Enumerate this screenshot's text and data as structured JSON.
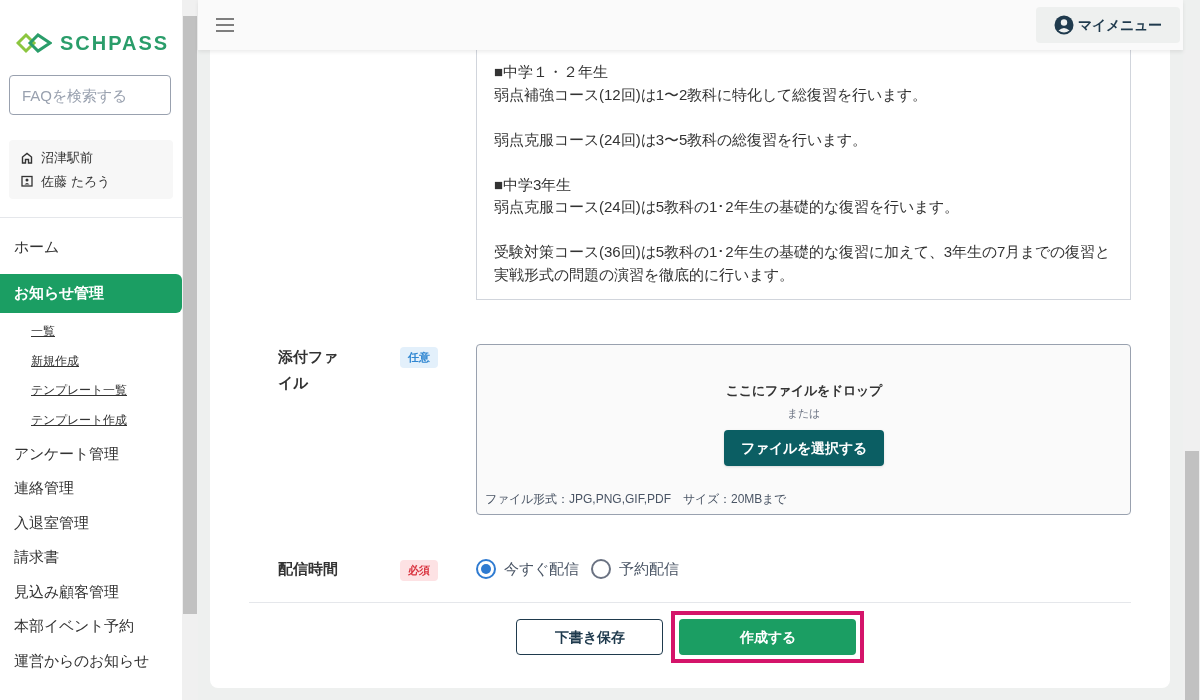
{
  "sidebar": {
    "logo": "SCHPASS",
    "search": {
      "placeholder": "FAQを検索する"
    },
    "school": "沼津駅前",
    "user": "佐藤 たろう",
    "items": [
      {
        "label": "ホーム",
        "selected": false
      },
      {
        "label": "お知らせ管理",
        "selected": true,
        "children": [
          {
            "label": "一覧"
          },
          {
            "label": "新規作成"
          },
          {
            "label": "テンプレート一覧"
          },
          {
            "label": "テンプレート作成"
          }
        ]
      },
      {
        "label": "アンケート管理",
        "selected": false
      },
      {
        "label": "連絡管理",
        "selected": false
      },
      {
        "label": "入退室管理",
        "selected": false
      },
      {
        "label": "請求書",
        "selected": false
      },
      {
        "label": "見込み顧客管理",
        "selected": false
      },
      {
        "label": "本部イベント予約",
        "selected": false
      },
      {
        "label": "運営からのお知らせ",
        "selected": false
      }
    ]
  },
  "header": {
    "my_menu": "マイメニュー"
  },
  "body_text": [
    [
      "■中学１・２年生",
      "弱点補強コース(12回)は1〜2教科に特化して総復習を行います。"
    ],
    [
      "弱点克服コース(24回)は3〜5教科の総復習を行います。"
    ],
    [
      "■中学3年生",
      "弱点克服コース(24回)は5教科の1･2年生の基礎的な復習を行います。"
    ],
    [
      "受験対策コース(36回)は5教科の1･2年生の基礎的な復習に加えて、3年生の7月までの復習と実戦形式の問題の演習を徹底的に行います。"
    ]
  ],
  "attachment": {
    "label": "添付ファイル",
    "badge": {
      "text": "任意",
      "kind": "optional"
    },
    "drop_text": "ここにファイルをドロップ",
    "or": "または",
    "button": "ファイルを選択する",
    "note": "ファイル形式：JPG,PNG,GIF,PDF　サイズ：20MBまで"
  },
  "delivery": {
    "label": "配信時間",
    "badge": {
      "text": "必須",
      "kind": "required"
    },
    "options": [
      {
        "label": "今すぐ配信",
        "selected": true
      },
      {
        "label": "予約配信",
        "selected": false
      }
    ]
  },
  "actions": {
    "draft": "下書き保存",
    "create": "作成する",
    "create_highlighted": true
  }
}
